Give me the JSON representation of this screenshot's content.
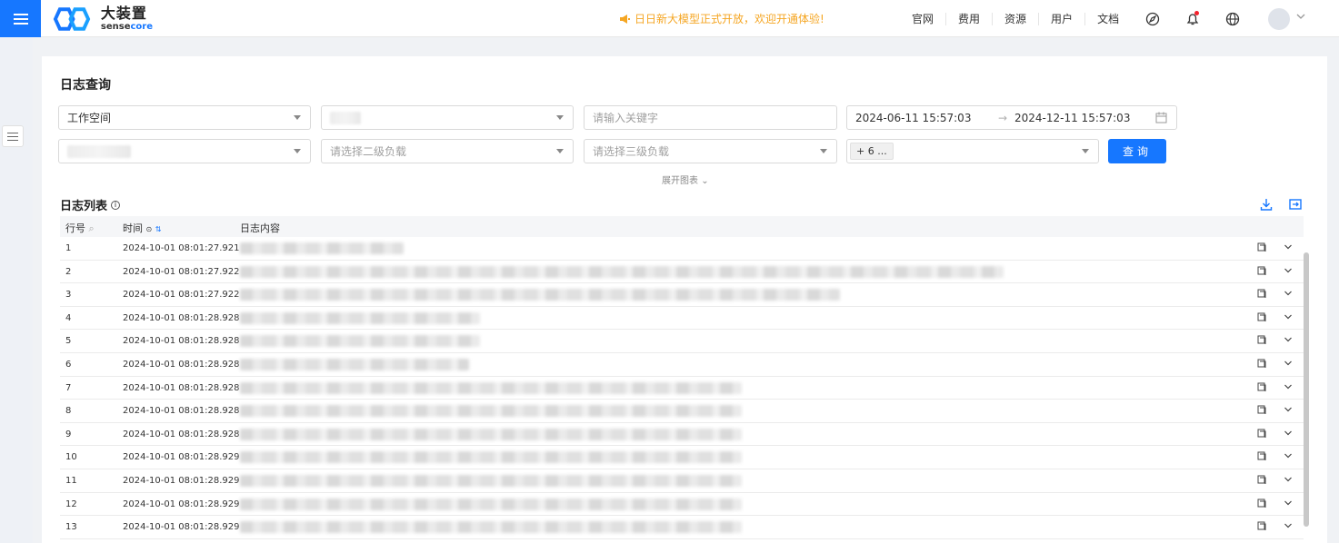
{
  "header": {
    "logo_title": "大装置",
    "logo_sub_a": "sense",
    "logo_sub_b": "core",
    "announcement": "日日新大模型正式开放，欢迎开通体验!",
    "nav": [
      "官网",
      "费用",
      "资源",
      "用户",
      "文档"
    ],
    "icons": [
      "compass-icon",
      "bell-icon",
      "globe-icon"
    ]
  },
  "page": {
    "title": "日志查询",
    "filters": {
      "workspace": "工作空间",
      "keyword_placeholder": "请输入关键字",
      "date_start": "2024-06-11 15:57:03",
      "date_end": "2024-12-11 15:57:03",
      "level2_placeholder": "请选择二级负载",
      "level3_placeholder": "请选择三级负载",
      "multi_tag": "+ 6 ...",
      "query_button": "查询",
      "expand_chart": "展开图表"
    },
    "list_title": "日志列表",
    "columns": {
      "no": "行号",
      "time": "时间",
      "content": "日志内容"
    },
    "rows": [
      {
        "no": "1",
        "time": "2024-10-01 08:01:27.921",
        "w": 180
      },
      {
        "no": "2",
        "time": "2024-10-01 08:01:27.922",
        "w": 840
      },
      {
        "no": "3",
        "time": "2024-10-01 08:01:27.922",
        "w": 660
      },
      {
        "no": "4",
        "time": "2024-10-01 08:01:28.928",
        "w": 264
      },
      {
        "no": "5",
        "time": "2024-10-01 08:01:28.928",
        "w": 264
      },
      {
        "no": "6",
        "time": "2024-10-01 08:01:28.928",
        "w": 252
      },
      {
        "no": "7",
        "time": "2024-10-01 08:01:28.928",
        "w": 552
      },
      {
        "no": "8",
        "time": "2024-10-01 08:01:28.928",
        "w": 552
      },
      {
        "no": "9",
        "time": "2024-10-01 08:01:28.928",
        "w": 552
      },
      {
        "no": "10",
        "time": "2024-10-01 08:01:28.929",
        "w": 552
      },
      {
        "no": "11",
        "time": "2024-10-01 08:01:28.929",
        "w": 552
      },
      {
        "no": "12",
        "time": "2024-10-01 08:01:28.929",
        "w": 552
      },
      {
        "no": "13",
        "time": "2024-10-01 08:01:28.929",
        "w": 552
      }
    ]
  },
  "colors": {
    "primary": "#1677ff",
    "announce": "#f5a623"
  }
}
